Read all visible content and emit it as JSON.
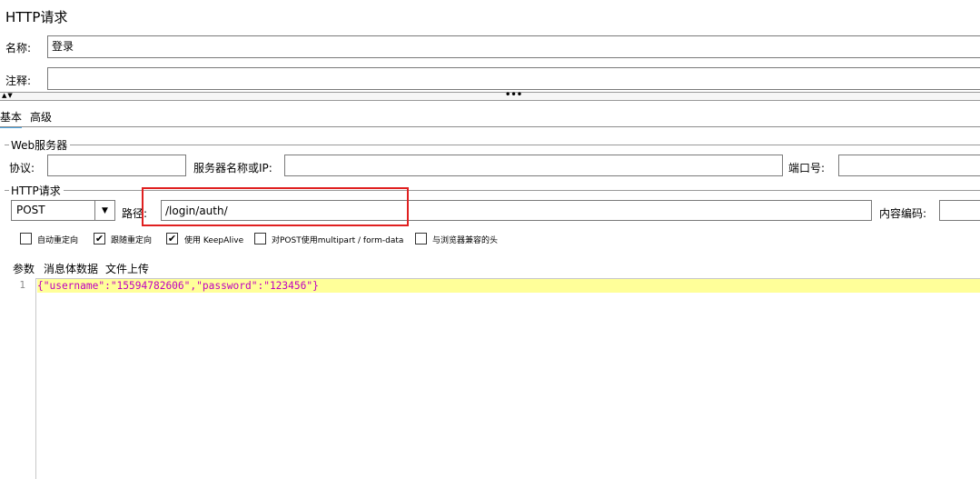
{
  "title": "HTTP请求",
  "name": {
    "label": "名称:",
    "value": "登录"
  },
  "comment": {
    "label": "注释:",
    "value": ""
  },
  "tabs": [
    {
      "label": "基本",
      "active": true
    },
    {
      "label": "高级",
      "active": false
    }
  ],
  "web_server": {
    "group_label": "Web服务器",
    "protocol_label": "协议:",
    "protocol_value": "",
    "server_label": "服务器名称或IP:",
    "server_value": "",
    "port_label": "端口号:",
    "port_value": ""
  },
  "http_request": {
    "group_label": "HTTP请求",
    "method": "POST",
    "path_label": "路径:",
    "path_value": "/login/auth/",
    "encoding_label": "内容编码:",
    "encoding_value": ""
  },
  "checkboxes": [
    {
      "label": "自动重定向",
      "checked": false
    },
    {
      "label": "跟随重定向",
      "checked": true
    },
    {
      "label": "使用 KeepAlive",
      "checked": true
    },
    {
      "label": "对POST使用multipart / form-data",
      "checked": false
    },
    {
      "label": "与浏览器兼容的头",
      "checked": false
    }
  ],
  "subtabs": [
    {
      "label": "参数",
      "active": false
    },
    {
      "label": "消息体数据",
      "active": true
    },
    {
      "label": "文件上传",
      "active": false
    }
  ],
  "editor": {
    "line_number": "1",
    "body": "{\"username\":\"15594782606\",\"password\":\"123456\"}"
  },
  "colors": {
    "highlight_box": "#e02020",
    "tab_underline": "#4aa3df",
    "current_line": "#ffff99",
    "string": "#c000c0"
  },
  "icons": {
    "splitter_arrows": "collapse-expand-icon",
    "splitter_dots": "drag-handle-icon",
    "combo_arrow": "chevron-down-icon",
    "check": "check-icon"
  }
}
